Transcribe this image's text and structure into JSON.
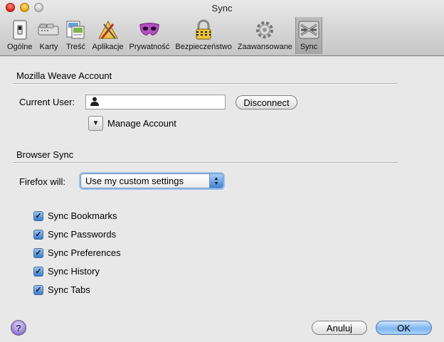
{
  "window": {
    "title": "Sync"
  },
  "toolbar": {
    "items": [
      {
        "label": "Ogólne",
        "icon": "general-switch-icon"
      },
      {
        "label": "Karty",
        "icon": "tabs-icon"
      },
      {
        "label": "Treść",
        "icon": "content-icon"
      },
      {
        "label": "Aplikacje",
        "icon": "applications-icon"
      },
      {
        "label": "Prywatność",
        "icon": "privacy-mask-icon"
      },
      {
        "label": "Bezpieczeństwo",
        "icon": "security-padlock-icon"
      },
      {
        "label": "Zaawansowane",
        "icon": "advanced-gear-icon"
      },
      {
        "label": "Sync",
        "icon": "sync-weave-icon",
        "selected": true
      }
    ]
  },
  "account": {
    "section_title": "Mozilla Weave Account",
    "current_user_label": "Current User:",
    "current_user_value": "",
    "disconnect_label": "Disconnect",
    "manage_label": "Manage Account"
  },
  "browser_sync": {
    "section_title": "Browser Sync",
    "firefox_will_label": "Firefox will:",
    "selected_option": "Use my custom settings",
    "checkboxes": [
      {
        "label": "Sync Bookmarks",
        "checked": true
      },
      {
        "label": "Sync Passwords",
        "checked": true
      },
      {
        "label": "Sync Preferences",
        "checked": true
      },
      {
        "label": "Sync History",
        "checked": true
      },
      {
        "label": "Sync Tabs",
        "checked": true
      }
    ]
  },
  "footer": {
    "cancel_label": "Anuluj",
    "ok_label": "OK",
    "help_glyph": "?"
  },
  "colors": {
    "accent": "#3a7bd0",
    "selected_tab": "#a6a6a6"
  }
}
